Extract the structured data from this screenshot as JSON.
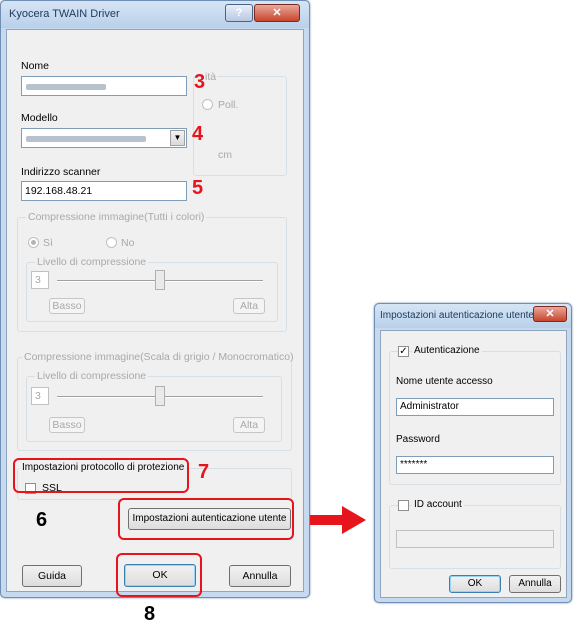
{
  "main_dialog": {
    "title": "Kyocera TWAIN Driver",
    "name_label": "Nome",
    "model_label": "Modello",
    "scanner_address_label": "Indirizzo scanner",
    "scanner_address_value": "192.168.48.21",
    "unit_group": {
      "partial_label": "ità",
      "inch_label": "Poll.",
      "cm_label": "cm"
    },
    "compression_color": {
      "title": "Compressione immagine(Tutti i colori)",
      "yes_label": "Sì",
      "no_label": "No",
      "level_title": "Livello di compressione",
      "level_value": "3",
      "low_label": "Basso",
      "high_label": "Alta"
    },
    "compression_gray": {
      "title": "Compressione immagine(Scala di grigio / Monocromatico)",
      "level_title": "Livello di compressione",
      "level_value": "3",
      "low_label": "Basso",
      "high_label": "Alta"
    },
    "protocol_group": {
      "title": "Impostazioni protocollo di protezione",
      "ssl_label": "SSL"
    },
    "auth_settings_button": "Impostazioni autenticazione utente",
    "help_button": "Guida",
    "ok_button": "OK",
    "cancel_button": "Annulla"
  },
  "auth_dialog": {
    "title": "Impostazioni autenticazione utente",
    "auth_checkbox_label": "Autenticazione",
    "username_label": "Nome utente accesso",
    "username_value": "Administrator",
    "password_label": "Password",
    "password_value": "*******",
    "id_account_label": "ID account",
    "ok_button": "OK",
    "cancel_button": "Annulla"
  },
  "callouts": {
    "n3": "3",
    "n4": "4",
    "n5": "5",
    "n6": "6",
    "n7": "7",
    "n8": "8"
  },
  "colors": {
    "callout_red": "#e8141c",
    "window_frame": "#c6d9ee"
  }
}
